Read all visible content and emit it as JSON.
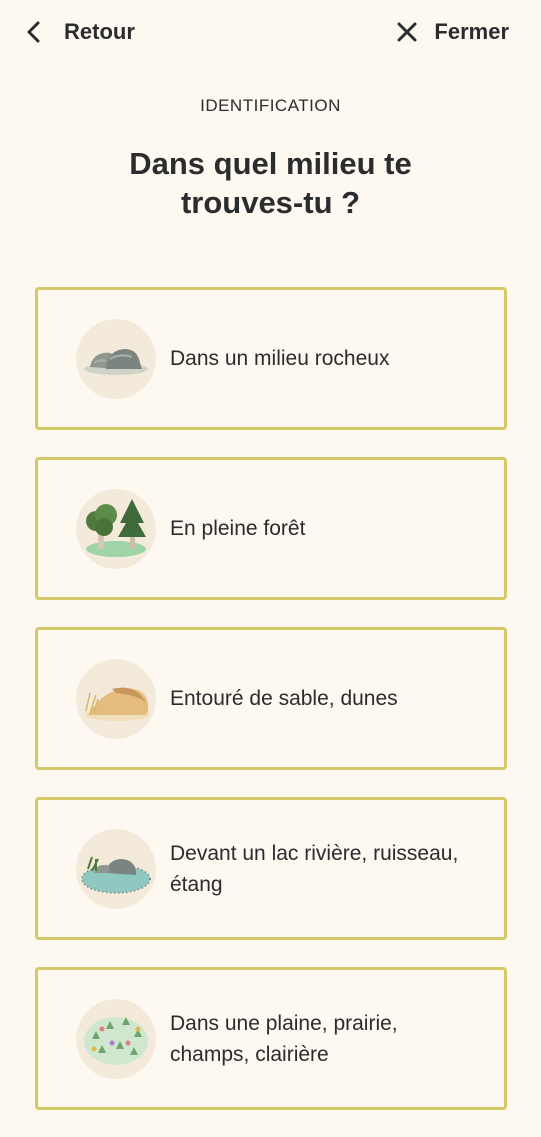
{
  "nav": {
    "back_label": "Retour",
    "close_label": "Fermer"
  },
  "header": {
    "eyebrow": "IDENTIFICATION",
    "title": "Dans quel milieu te trouves-tu ?"
  },
  "options": [
    {
      "label": "Dans un milieu rocheux",
      "icon": "rocks-icon"
    },
    {
      "label": "En pleine forêt",
      "icon": "forest-icon"
    },
    {
      "label": "Entouré de sable, dunes",
      "icon": "dunes-icon"
    },
    {
      "label": "Devant un lac rivière, ruisseau, étang",
      "icon": "lake-icon"
    },
    {
      "label": "Dans une plaine, prairie, champs, clairière",
      "icon": "meadow-icon"
    }
  ],
  "colors": {
    "background": "#fdf9f1",
    "option_border": "#d5c866",
    "thumb_bg": "#f4eadb",
    "text": "#2a2c2e"
  }
}
